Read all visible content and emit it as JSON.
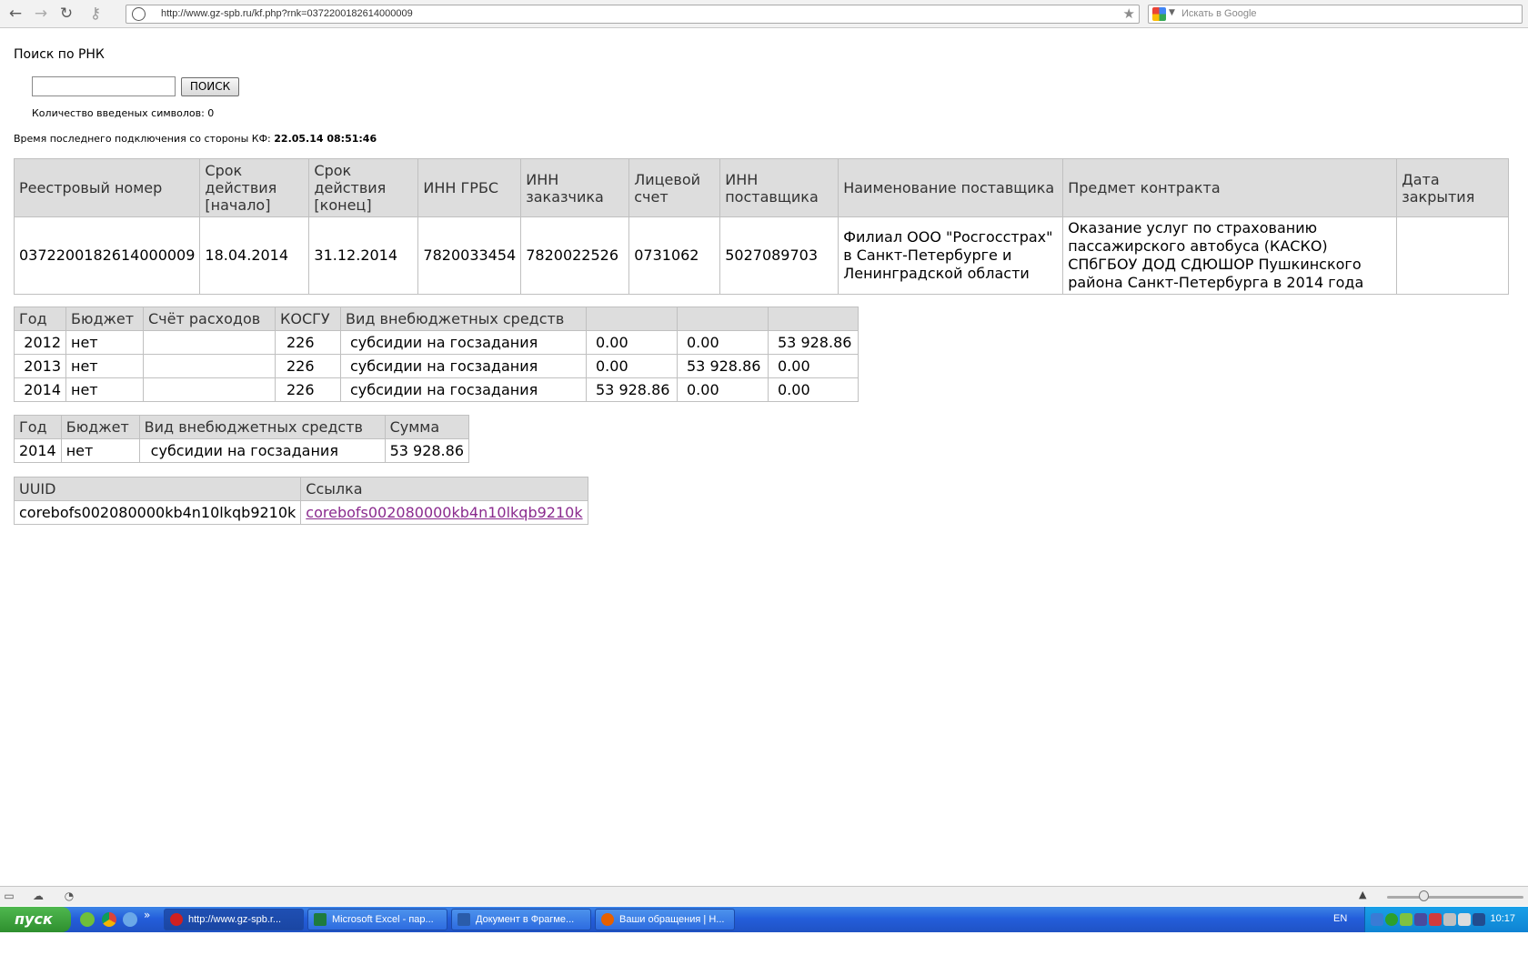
{
  "browser": {
    "url": "http://www.gz-spb.ru/kf.php?rnk=0372200182614000009",
    "search_placeholder": "Искать в Google"
  },
  "page": {
    "title": "Поиск по РНК",
    "search_button": "ПОИСК",
    "input_value": "",
    "count_label": "Количество введеных символов: 0",
    "last_conn_label": "Время последнего подключения со стороны КФ:",
    "last_conn_value": "22.05.14 08:51:46"
  },
  "contract_table": {
    "headers": [
      "Реестровый номер",
      "Срок действия [начало]",
      "Срок действия [конец]",
      "ИНН ГРБС",
      "ИНН заказчика",
      "Лицевой счет",
      "ИНН поставщика",
      "Наименование поставщика",
      "Предмет контракта",
      "Дата закрытия"
    ],
    "row": [
      "0372200182614000009",
      "18.04.2014",
      "31.12.2014",
      "7820033454",
      "7820022526",
      "0731062",
      "5027089703",
      "Филиал ООО \"Росгосстрах\" в Санкт-Петербурге и Ленинградской области",
      "Оказание услуг по страхованию пассажирского автобуса (КАСКО) СПбГБОУ ДОД СДЮШОР Пушкинского района Санкт-Петербурга в 2014 года",
      ""
    ]
  },
  "finance_table": {
    "headers": [
      "Год",
      "Бюджет",
      "Счёт расходов",
      "КОСГУ",
      "Вид внебюджетных средств",
      "",
      "",
      ""
    ],
    "rows": [
      [
        "2012",
        "нет",
        "",
        "226",
        "субсидии на госзадания",
        "0.00",
        "0.00",
        "53 928.86"
      ],
      [
        "2013",
        "нет",
        "",
        "226",
        "субсидии на госзадания",
        "0.00",
        "53 928.86",
        "0.00"
      ],
      [
        "2014",
        "нет",
        "",
        "226",
        "субсидии на госзадания",
        "53 928.86",
        "0.00",
        "0.00"
      ]
    ]
  },
  "sum_table": {
    "headers": [
      "Год",
      "Бюджет",
      "Вид внебюджетных средств",
      "Сумма"
    ],
    "row": [
      "2014",
      "нет",
      "субсидии на госзадания",
      "53 928.86"
    ]
  },
  "uuid_table": {
    "headers": [
      "UUID",
      "Ссылка"
    ],
    "uuid": "corebofs002080000kb4n10lkqb9210k",
    "link": "corebofs002080000kb4n10lkqb9210k"
  },
  "taskbar": {
    "start_label": "пуск",
    "tasks": [
      "http://www.gz-spb.r...",
      "Microsoft Excel - пар...",
      "Документ в Фрагме...",
      "Ваши обращения | Н..."
    ],
    "lang": "EN",
    "clock": "10:17"
  }
}
